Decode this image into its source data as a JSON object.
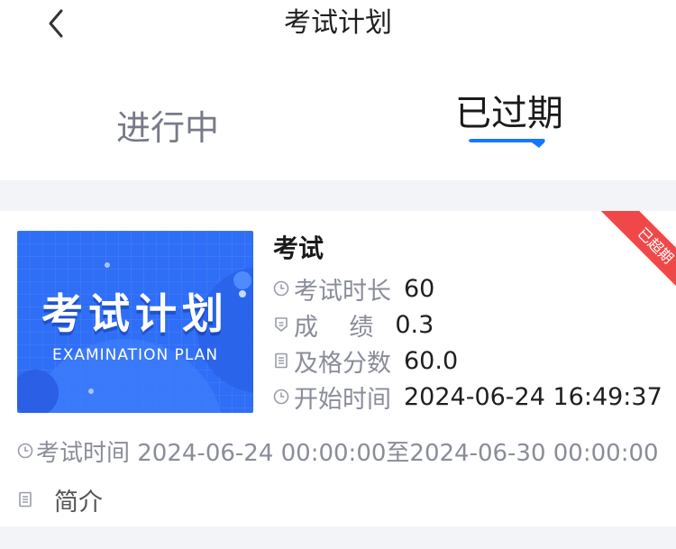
{
  "header": {
    "title": "考试计划",
    "back_icon": "chevron-left-icon"
  },
  "tabs": [
    {
      "label": "进行中",
      "active": false
    },
    {
      "label": "已过期",
      "active": true
    }
  ],
  "colors": {
    "accent": "#1677ff",
    "badge": "#f04848",
    "muted": "#8a8d99"
  },
  "card": {
    "thumbnail": {
      "title": "考试计划",
      "subtitle": "EXAMINATION PLAN"
    },
    "badge": "已超期",
    "name": "考试",
    "rows": [
      {
        "icon": "clock-icon",
        "label": "考试时长",
        "value": "60"
      },
      {
        "icon": "shield-icon",
        "label": "成    绩",
        "value": "0.3"
      },
      {
        "icon": "document-icon",
        "label": "及格分数",
        "value": "60.0"
      },
      {
        "icon": "clock-icon",
        "label": "开始时间",
        "value": "2024-06-24 16:49:37"
      }
    ],
    "exam_time": "考试时间 2024-06-24 00:00:00至2024-06-30 00:00:00",
    "intro_label": "简介"
  }
}
